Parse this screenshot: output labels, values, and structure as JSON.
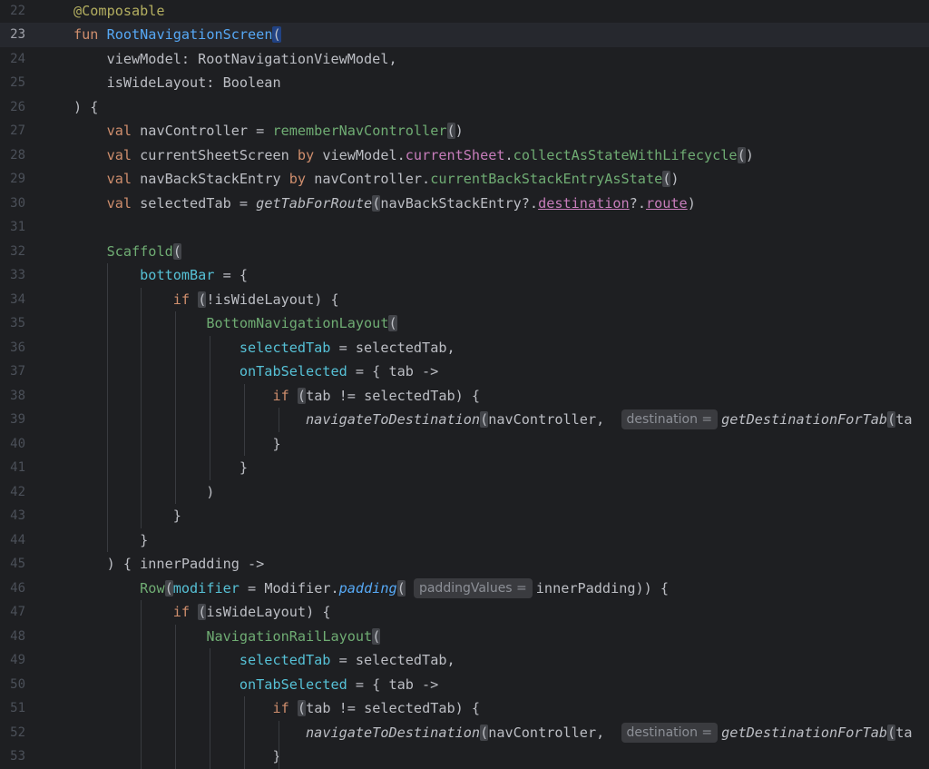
{
  "editor": {
    "current_line": "23",
    "lines": [
      {
        "n": "22",
        "html": "<span class=\"ann\">@Composable</span>"
      },
      {
        "n": "23",
        "html": "<span class=\"kw\">fun</span> <span class=\"fn-decl\">RootNavigationScreen</span><span class=\"hl\">(</span>"
      },
      {
        "n": "24",
        "html": "    viewModel: RootNavigationViewModel,"
      },
      {
        "n": "25",
        "html": "    isWideLayout: Boolean"
      },
      {
        "n": "26",
        "html": ") {"
      },
      {
        "n": "27",
        "html": "    <span class=\"kw\">val</span> navController = <span class=\"call\">rememberNavController</span><span class=\"hl-paren\">(</span>)"
      },
      {
        "n": "28",
        "html": "    <span class=\"kw\">val</span> currentSheetScreen <span class=\"kw\">by</span> viewModel.<span class=\"prop\">currentSheet</span>.<span class=\"call\">collectAsStateWithLifecycle</span><span class=\"hl-paren\">(</span>)"
      },
      {
        "n": "29",
        "html": "    <span class=\"kw\">val</span> navBackStackEntry <span class=\"kw\">by</span> navController.<span class=\"call\">currentBackStackEntryAsState</span><span class=\"hl-paren\">(</span>)"
      },
      {
        "n": "30",
        "html": "    <span class=\"kw\">val</span> selectedTab = <span class=\"italic\">getTabForRoute</span><span class=\"hl-paren\">(</span>navBackStackEntry?.<span class=\"prop ul\">destination</span>?.<span class=\"prop ul\">route</span>)"
      },
      {
        "n": "31",
        "html": ""
      },
      {
        "n": "32",
        "html": "    <span class=\"call\">Scaffold</span><span class=\"hl-paren\">(</span>"
      },
      {
        "n": "33",
        "html": "        <span class=\"named\">bottomBar</span> = {"
      },
      {
        "n": "34",
        "html": "            <span class=\"kw\">if</span> <span class=\"hl-paren\">(</span>!isWideLayout) {"
      },
      {
        "n": "35",
        "html": "                <span class=\"call\">BottomNavigationLayout</span><span class=\"hl-paren\">(</span>"
      },
      {
        "n": "36",
        "html": "                    <span class=\"named\">selectedTab</span> = selectedTab,"
      },
      {
        "n": "37",
        "html": "                    <span class=\"named\">onTabSelected</span> = { tab ->"
      },
      {
        "n": "38",
        "html": "                        <span class=\"kw\">if</span> <span class=\"hl-paren\">(</span>tab != selectedTab) {"
      },
      {
        "n": "39",
        "html": "                            <span class=\"italic\">navigateToDestination</span><span class=\"hl-paren\">(</span>navController,  <span class=\"hint\">destination =</span><span class=\"italic\">getDestinationForTab</span><span class=\"hl-paren\">(</span>ta"
      },
      {
        "n": "40",
        "html": "                        }"
      },
      {
        "n": "41",
        "html": "                    }"
      },
      {
        "n": "42",
        "html": "                )"
      },
      {
        "n": "43",
        "html": "            }"
      },
      {
        "n": "44",
        "html": "        }"
      },
      {
        "n": "45",
        "html": "    ) { innerPadding ->"
      },
      {
        "n": "46",
        "html": "        <span class=\"call\">Row</span><span class=\"hl-paren\">(</span><span class=\"named\">modifier</span> = Modifier.<span class=\"comp italic\">padding</span><span class=\"hl-paren\">(</span> <span class=\"hint\">paddingValues =</span>innerPadding)) {"
      },
      {
        "n": "47",
        "html": "            <span class=\"kw\">if</span> <span class=\"hl-paren\">(</span>isWideLayout) {"
      },
      {
        "n": "48",
        "html": "                <span class=\"call\">NavigationRailLayout</span><span class=\"hl-paren\">(</span>"
      },
      {
        "n": "49",
        "html": "                    <span class=\"named\">selectedTab</span> = selectedTab,"
      },
      {
        "n": "50",
        "html": "                    <span class=\"named\">onTabSelected</span> = { tab ->"
      },
      {
        "n": "51",
        "html": "                        <span class=\"kw\">if</span> <span class=\"hl-paren\">(</span>tab != selectedTab) {"
      },
      {
        "n": "52",
        "html": "                            <span class=\"italic\">navigateToDestination</span><span class=\"hl-paren\">(</span>navController,  <span class=\"hint\">destination =</span><span class=\"italic\">getDestinationForTab</span><span class=\"hl-paren\">(</span>ta"
      },
      {
        "n": "53",
        "html": "                        }"
      }
    ]
  },
  "colors": {
    "background": "#1e1f22",
    "keyword": "#cf8e6d",
    "annotation": "#b3ae60",
    "function_declaration": "#56a8f5",
    "composable_call": "#6fac73",
    "named_argument": "#56c1d6",
    "property": "#c77dbb",
    "plain_text": "#bcbec4",
    "line_number": "#4b5059"
  }
}
